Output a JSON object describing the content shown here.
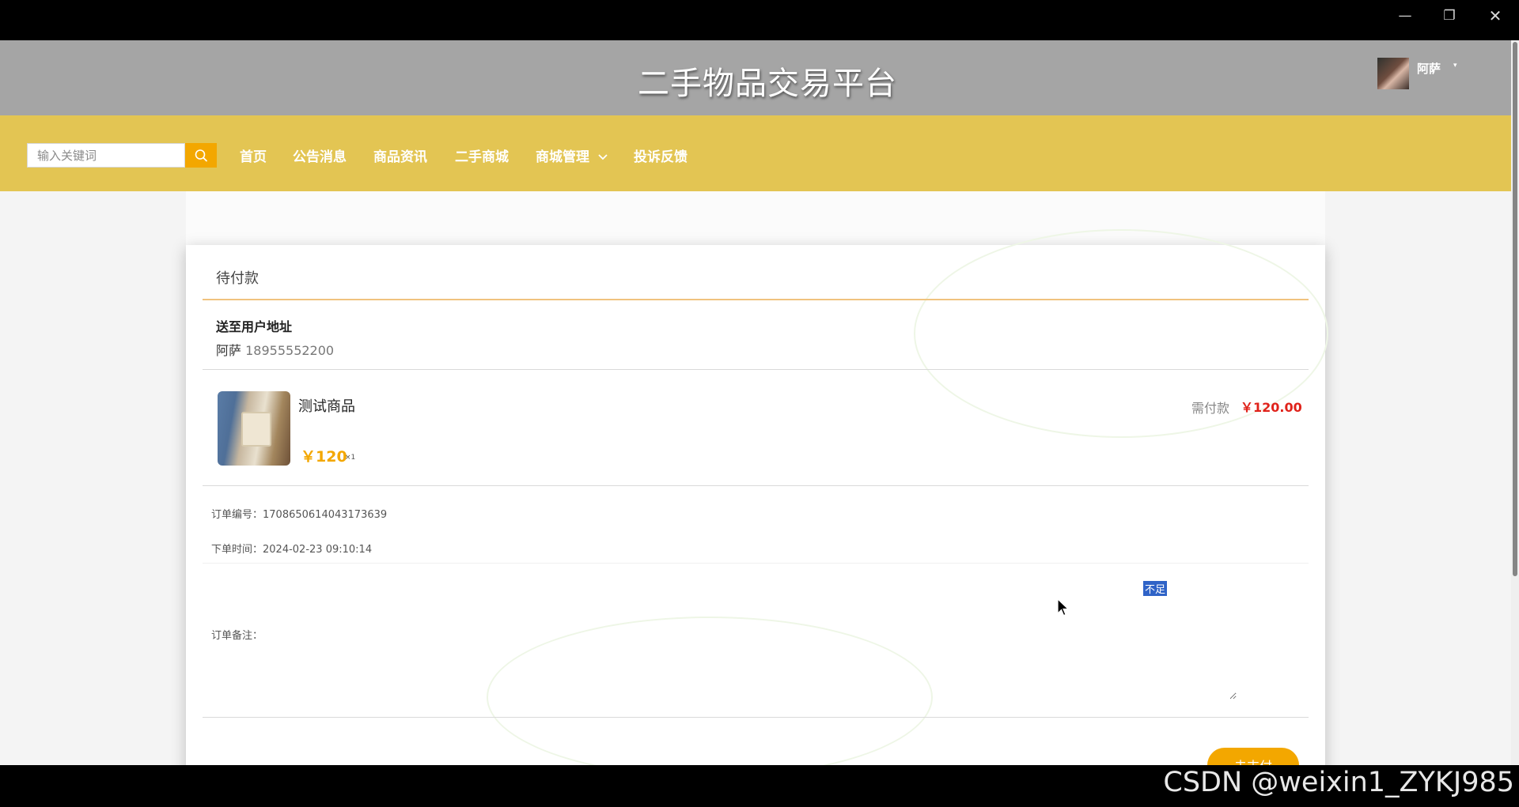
{
  "window": {
    "minimize": "—",
    "restore": "❐",
    "close": "✕"
  },
  "header": {
    "site_title": "二手物品交易平台",
    "username": "阿萨",
    "user_caret": "▾"
  },
  "search": {
    "placeholder": "输入关键词"
  },
  "nav": {
    "home": "首页",
    "notices": "公告消息",
    "news": "商品资讯",
    "mall": "二手商城",
    "manage": "商城管理",
    "feedback": "投诉反馈"
  },
  "order": {
    "status": "待付款",
    "address_heading": "送至用户地址",
    "recipient_name": "阿萨",
    "recipient_phone": "18955552200",
    "product_name": "测试商品",
    "product_price": "￥120",
    "product_qty": "×1",
    "pay_label": "需付款",
    "pay_amount": "￥120.00",
    "order_no_label": "订单编号：",
    "order_no": "1708650614043173639",
    "order_time_label": "下单时间：",
    "order_time": "2024-02-23 09:10:14",
    "note_label": "订单备注：",
    "selected_text": "不足",
    "pay_button": "去支付"
  },
  "watermark": "CSDN @weixin1_ZYKJ985",
  "colors": {
    "header_bg": "#a5a5a5",
    "nav_bg": "#e3c553",
    "accent": "#f3a700",
    "price_red": "#e0221a"
  },
  "icons": {
    "search": "search-icon",
    "chevron": "chevron-down-icon",
    "cursor": "mouse-pointer-icon"
  }
}
